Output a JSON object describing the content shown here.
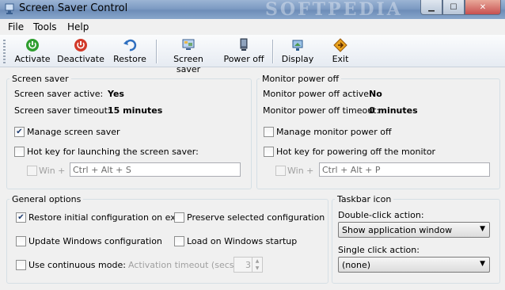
{
  "window": {
    "title": "Screen Saver Control",
    "watermark": "SOFTPEDIA"
  },
  "menu": [
    "File",
    "Tools",
    "Help"
  ],
  "toolbar": {
    "activate": "Activate",
    "deactivate": "Deactivate",
    "restore": "Restore",
    "screen_saver": "Screen saver",
    "power_off": "Power off",
    "display": "Display",
    "exit": "Exit"
  },
  "screen_saver": {
    "group_label": "Screen saver",
    "active_label": "Screen saver active:",
    "active_value": "Yes",
    "timeout_label": "Screen saver timeout:",
    "timeout_value": "15 minutes",
    "manage_label": "Manage screen saver",
    "manage_checked": true,
    "hotkey_label": "Hot key for launching the screen saver:",
    "hotkey_checked": false,
    "win_label": "Win +",
    "hotkey_value": "Ctrl + Alt + S"
  },
  "monitor": {
    "group_label": "Monitor power off",
    "active_label": "Monitor power off active:",
    "active_value": "No",
    "timeout_label": "Monitor power off timeout:",
    "timeout_value": "0 minutes",
    "manage_label": "Manage monitor power off",
    "manage_checked": false,
    "hotkey_label": "Hot key for powering off the monitor",
    "hotkey_checked": false,
    "win_label": "Win +",
    "hotkey_value": "Ctrl + Alt + P"
  },
  "general": {
    "group_label": "General options",
    "restore_label": "Restore initial configuration on exit",
    "restore_checked": true,
    "preserve_label": "Preserve selected configuration",
    "preserve_checked": false,
    "update_label": "Update Windows configuration",
    "update_checked": false,
    "startup_label": "Load on Windows startup",
    "startup_checked": false,
    "continuous_label": "Use continuous mode:",
    "continuous_checked": false,
    "activation_label": "Activation timeout (secs.):",
    "activation_value": "3"
  },
  "taskbar": {
    "group_label": "Taskbar icon",
    "double_click_label": "Double-click action:",
    "double_click_value": "Show application window",
    "single_click_label": "Single click action:",
    "single_click_value": "(none)"
  },
  "colors": {
    "activate_icon": "#2f9e2f",
    "deactivate_icon": "#d23a2a",
    "title_bar": "#7d9bc3"
  }
}
